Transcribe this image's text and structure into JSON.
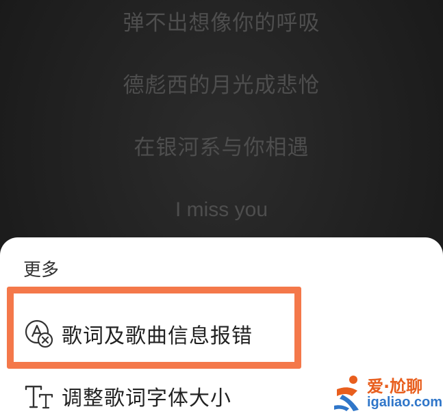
{
  "lyrics": {
    "lines": [
      "弹不出想像你的呼吸",
      "德彪西的月光成悲怆",
      "在银河系与你相遇",
      "I miss you"
    ]
  },
  "sheet": {
    "title": "更多",
    "items": [
      {
        "label": "歌词及歌曲信息报错",
        "icon": "lyrics-error-report-icon"
      },
      {
        "label": "调整歌词字体大小",
        "icon": "font-size-icon"
      }
    ]
  },
  "watermark": {
    "text_cn": "爱·尬聊",
    "text_en": "igaliao.com"
  },
  "colors": {
    "highlight": "#f4784a",
    "watermark_orange": "#e85e1d",
    "watermark_blue": "#2f76c9"
  }
}
